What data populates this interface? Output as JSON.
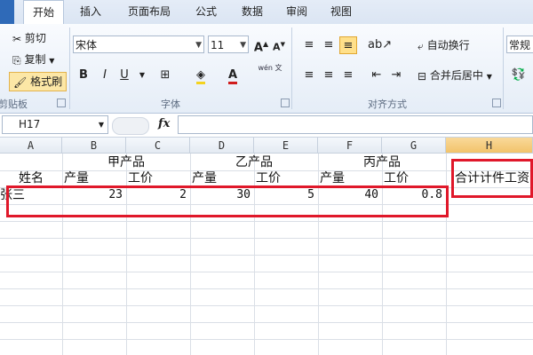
{
  "ribbon_tabs": [
    "开始",
    "插入",
    "页面布局",
    "公式",
    "数据",
    "审阅",
    "视图"
  ],
  "clipboard": {
    "cut": "剪切",
    "copy": "复制",
    "format_painter": "格式刷",
    "group": "剪贴板"
  },
  "font": {
    "name": "宋体",
    "size": "11",
    "group": "字体",
    "bold": "B",
    "italic": "I",
    "underline": "U",
    "wen": "wén 文"
  },
  "alignment": {
    "wrap": "自动换行",
    "merge": "合并后居中",
    "group": "对齐方式"
  },
  "number": {
    "format": "常规"
  },
  "formula_bar": {
    "name_box": "H17",
    "fx": "fx",
    "content": ""
  },
  "columns": [
    "A",
    "B",
    "C",
    "D",
    "E",
    "F",
    "G",
    "H"
  ],
  "sheet": {
    "row1": {
      "product1": "甲产品",
      "product2": "乙产品",
      "product3": "丙产品"
    },
    "row2": {
      "name": "姓名",
      "b": "产量",
      "c": "工价",
      "d": "产量",
      "e": "工价",
      "f": "产量",
      "g": "工价",
      "h": "合计计件工资"
    },
    "row3": {
      "name": "张三",
      "b": "23",
      "c": "2",
      "d": "30",
      "e": "5",
      "f": "40",
      "g": "0.8"
    }
  },
  "colors": {
    "highlight_box": "#e0182a",
    "selected_col": "#f2c36a"
  }
}
